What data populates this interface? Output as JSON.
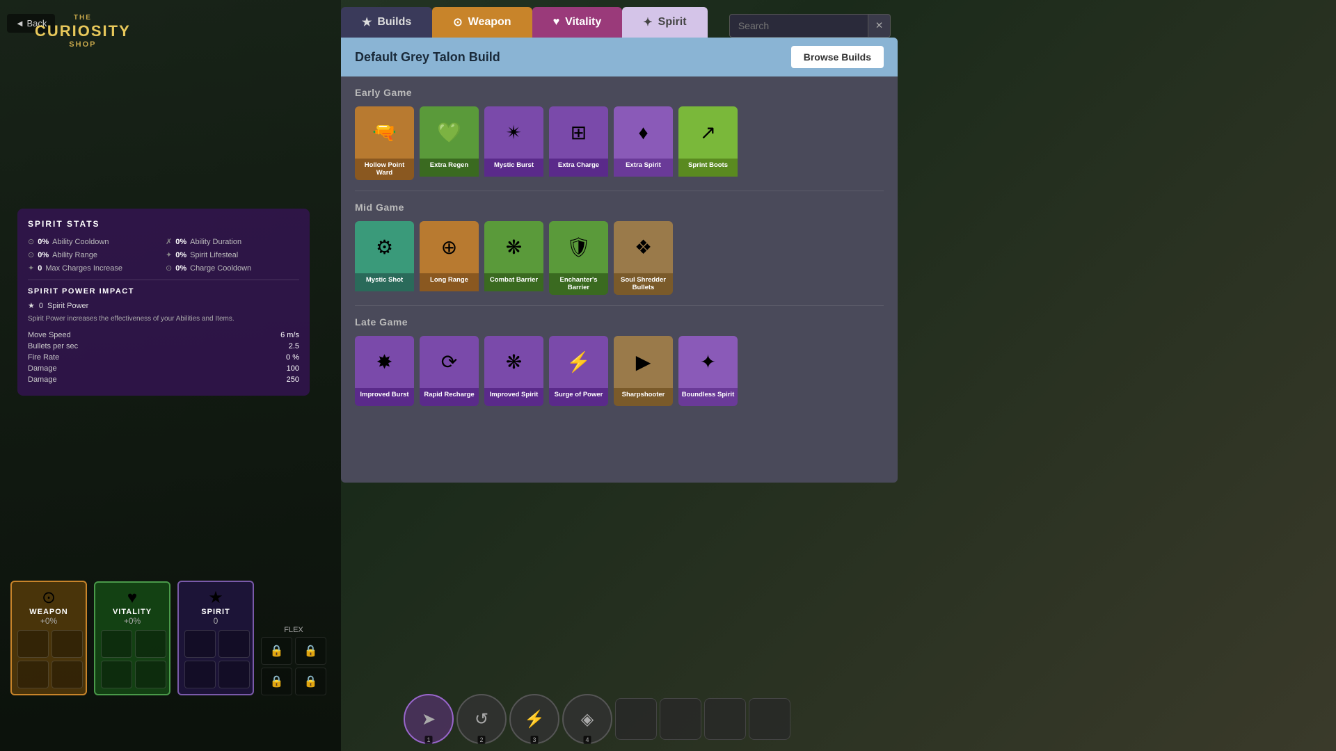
{
  "app": {
    "title": "The Curiosity Shop"
  },
  "back_button": "◄ Back",
  "tabs": [
    {
      "id": "builds",
      "label": "Builds",
      "icon": "★",
      "active": false
    },
    {
      "id": "weapon",
      "label": "Weapon",
      "icon": "⊙",
      "active": true
    },
    {
      "id": "vitality",
      "label": "Vitality",
      "icon": "♥",
      "active": false
    },
    {
      "id": "spirit",
      "label": "Spirit",
      "icon": "✦",
      "active": false
    }
  ],
  "search": {
    "placeholder": "Search",
    "value": ""
  },
  "build": {
    "title": "Default Grey Talon Build",
    "browse_builds_label": "Browse Builds"
  },
  "sections": [
    {
      "id": "early_game",
      "title": "Early Game",
      "items": [
        {
          "name": "Hollow Point Ward",
          "icon": "🔫",
          "color": "orange"
        },
        {
          "name": "Extra Regen",
          "icon": "💚",
          "color": "green"
        },
        {
          "name": "Mystic Burst",
          "icon": "✴",
          "color": "purple"
        },
        {
          "name": "Extra Charge",
          "icon": "⊞",
          "color": "purple"
        },
        {
          "name": "Extra Spirit",
          "icon": "♦",
          "color": "purple2"
        },
        {
          "name": "Sprint Boots",
          "icon": "↗",
          "color": "lt-green"
        }
      ]
    },
    {
      "id": "mid_game",
      "title": "Mid Game",
      "items": [
        {
          "name": "Mystic Shot",
          "icon": "⚙",
          "color": "teal"
        },
        {
          "name": "Long Range",
          "icon": "⊕",
          "color": "orange"
        },
        {
          "name": "Combat Barrier",
          "icon": "❋",
          "color": "green"
        },
        {
          "name": "Enchanter's Barrier",
          "icon": "🛡",
          "color": "green"
        },
        {
          "name": "Soul Shredder Bullets",
          "icon": "❖",
          "color": "brown"
        }
      ]
    },
    {
      "id": "late_game",
      "title": "Late Game",
      "items": [
        {
          "name": "Improved Burst",
          "icon": "✸",
          "color": "purple"
        },
        {
          "name": "Rapid Recharge",
          "icon": "⟳",
          "color": "purple"
        },
        {
          "name": "Improved Spirit",
          "icon": "❋",
          "color": "purple"
        },
        {
          "name": "Surge of Power",
          "icon": "⚡",
          "color": "purple"
        },
        {
          "name": "Sharpshooter",
          "icon": "▶",
          "color": "brown"
        },
        {
          "name": "Boundless Spirit",
          "icon": "✦",
          "color": "purple2"
        }
      ]
    }
  ],
  "spirit_stats": {
    "title": "SPIRIT STATS",
    "stats": [
      {
        "icon": "⊙",
        "value": "0%",
        "label": "Ability Cooldown"
      },
      {
        "icon": "✗",
        "value": "0%",
        "label": "Ability Duration"
      },
      {
        "icon": "⊙",
        "value": "0%",
        "label": "Ability Range"
      },
      {
        "icon": "✦",
        "value": "0%",
        "label": "Spirit Lifesteal"
      },
      {
        "icon": "✦",
        "value": "0",
        "label": "Max Charges Increase"
      },
      {
        "icon": "⊙",
        "value": "0%",
        "label": "Charge Cooldown"
      }
    ]
  },
  "spirit_power": {
    "title": "SPIRIT POWER IMPACT",
    "icon": "★",
    "value": "0",
    "label": "Spirit Power",
    "description": "Spirit Power increases the effectiveness of your Abilities and Items.",
    "stats": [
      {
        "label": "Move Speed",
        "value": "6 m/s"
      },
      {
        "label": "Bullets per sec",
        "value": "2.5"
      },
      {
        "label": "Fire Rate",
        "value": "0 %"
      },
      {
        "label": "Damage",
        "value": "100"
      },
      {
        "label": "Damage",
        "value": "250"
      }
    ]
  },
  "char_stats": [
    {
      "id": "weapon",
      "icon": "⊙",
      "name": "WEAPON",
      "value": "+0%",
      "color": "weapon"
    },
    {
      "id": "vitality",
      "icon": "♥",
      "name": "VITALITY",
      "value": "+0%",
      "color": "vitality"
    },
    {
      "id": "spirit",
      "icon": "★",
      "name": "SPIRIT",
      "value": "0",
      "color": "spirit"
    }
  ],
  "flex_label": "FLEX",
  "ability_slots": [
    {
      "icon": "➤",
      "num": "1",
      "active": true
    },
    {
      "icon": "↺",
      "num": "2",
      "active": false
    },
    {
      "icon": "⚡",
      "num": "3",
      "active": false
    },
    {
      "icon": "◈",
      "num": "4",
      "active": false
    }
  ]
}
